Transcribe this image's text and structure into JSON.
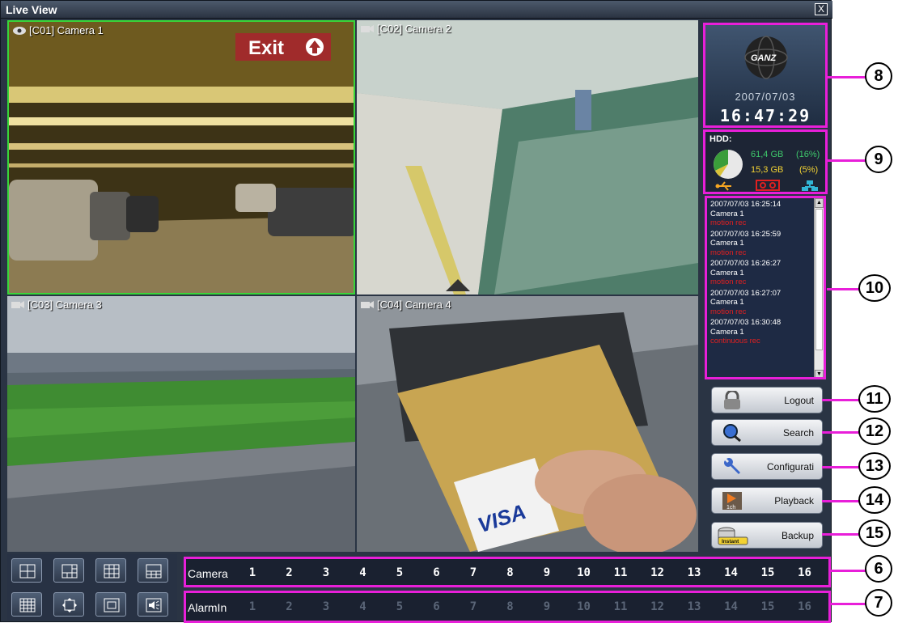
{
  "window": {
    "title": "Live View",
    "close_glyph": "X"
  },
  "cameras": [
    {
      "label": "[C01] Camera 1",
      "icon": "dome-camera-icon",
      "sign_text": "Exit"
    },
    {
      "label": "[C02] Camera 2",
      "icon": "camera-icon"
    },
    {
      "label": "[C03] Camera 3",
      "icon": "camera-icon"
    },
    {
      "label": "[C04] Camera 4",
      "icon": "camera-icon",
      "card_text": "VISA"
    }
  ],
  "info": {
    "logo_text": "GANZ",
    "date": "2007/07/03",
    "time": "16:47:29"
  },
  "hdd": {
    "label": "HDD:",
    "rows": [
      {
        "size": "61,4 GB",
        "pct": "(16%)",
        "color": "#3ec96b"
      },
      {
        "size": "15,3 GB",
        "pct": "(5%)",
        "color": "#f2d233"
      }
    ],
    "status_icons": [
      "usb-icon",
      "tape-icon",
      "network-icon"
    ]
  },
  "events": [
    {
      "time": "2007/07/03 16:25:14",
      "camera": "Camera 1",
      "event": "motion rec"
    },
    {
      "time": "2007/07/03 16:25:59",
      "camera": "Camera 1",
      "event": "motion rec"
    },
    {
      "time": "2007/07/03 16:26:27",
      "camera": "Camera 1",
      "event": "motion rec"
    },
    {
      "time": "2007/07/03 16:27:07",
      "camera": "Camera 1",
      "event": "motion rec"
    },
    {
      "time": "2007/07/03 16:30:48",
      "camera": "Camera 1",
      "event": "continuous rec"
    }
  ],
  "buttons": {
    "logout": "Logout",
    "search": "Search",
    "configuration": "Configurati",
    "playback": "Playback",
    "backup": "Backup",
    "playback_icon_text": "1ch",
    "backup_icon_text": "Instant"
  },
  "camera_strip": {
    "label": "Camera",
    "numbers": [
      "1",
      "2",
      "3",
      "4",
      "5",
      "6",
      "7",
      "8",
      "9",
      "10",
      "11",
      "12",
      "13",
      "14",
      "15",
      "16"
    ]
  },
  "alarm_strip": {
    "label": "AlarmIn",
    "numbers": [
      "1",
      "2",
      "3",
      "4",
      "5",
      "6",
      "7",
      "8",
      "9",
      "10",
      "11",
      "12",
      "13",
      "14",
      "15",
      "16"
    ]
  },
  "callouts": [
    "6",
    "7",
    "8",
    "9",
    "10",
    "11",
    "12",
    "13",
    "14",
    "15"
  ],
  "colors": {
    "highlight": "#e81fd9",
    "selected_border": "#38d63a",
    "event_red": "#e02020"
  }
}
